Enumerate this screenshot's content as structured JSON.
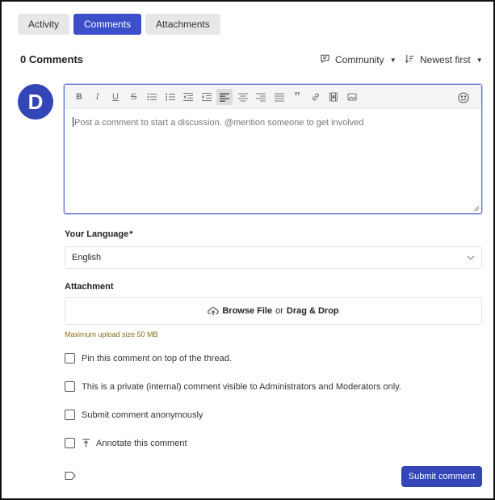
{
  "tabs": [
    {
      "label": "Activity",
      "active": false
    },
    {
      "label": "Comments",
      "active": true
    },
    {
      "label": "Attachments",
      "active": false
    }
  ],
  "comments": {
    "count_label": "0 Comments",
    "filter_label": "Community",
    "sort_label": "Newest first"
  },
  "avatar": {
    "initial": "D",
    "color": "#3346b8"
  },
  "editor": {
    "placeholder": "Post a comment to start a discussion. @mention someone to get involved",
    "toolbar": [
      "bold-icon",
      "italic-icon",
      "underline-icon",
      "strikethrough-icon",
      "bullet-list-icon",
      "numbered-list-icon",
      "outdent-icon",
      "indent-icon",
      "align-left-icon",
      "align-center-icon",
      "align-right-icon",
      "justify-icon",
      "quote-icon",
      "link-icon",
      "video-icon",
      "image-icon",
      "emoji-icon"
    ],
    "active_tool": "align-left-icon"
  },
  "language": {
    "label": "Your Language",
    "required_mark": "*",
    "value": "English"
  },
  "attachment": {
    "label": "Attachment",
    "browse": "Browse File",
    "or": "or",
    "drag": "Drag & Drop",
    "hint": "Maximum upload size 50 MB"
  },
  "options": [
    {
      "label": "Pin this comment on top of the thread.",
      "checked": false
    },
    {
      "label": "This is a private (internal) comment visible to Administrators and Moderators only.",
      "checked": false
    },
    {
      "label": "Submit comment anonymously",
      "checked": false
    },
    {
      "label": "Annotate this comment",
      "checked": false
    }
  ],
  "submit_label": "Submit comment",
  "colors": {
    "accent": "#3a4fc8",
    "hint": "#8a6a1a"
  }
}
